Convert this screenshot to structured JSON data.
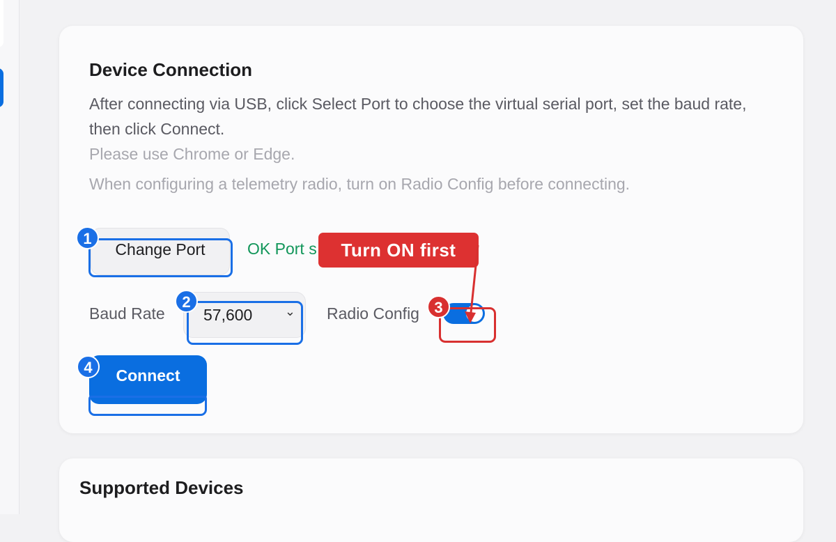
{
  "device_connection": {
    "title": "Device Connection",
    "description": "After connecting via USB, click Select Port to choose the virtual serial port, set the baud rate, then click Connect.",
    "note_browser": "Please use Chrome or Edge.",
    "note_radio": "When configuring a telemetry radio, turn on Radio Config before connecting.",
    "change_port_label": "Change Port",
    "port_status": "OK Port s",
    "baud_rate_label": "Baud Rate",
    "baud_rate_value": "57,600",
    "radio_config_label": "Radio Config",
    "radio_config_on": true,
    "connect_label": "Connect"
  },
  "supported_devices": {
    "title": "Supported Devices"
  },
  "annotations": {
    "callout_text": "Turn ON first",
    "steps": [
      "1",
      "2",
      "3",
      "4"
    ]
  },
  "colors": {
    "accent": "#0a6ee0",
    "success": "#12965a",
    "annotation_blue": "#1a6fe6",
    "annotation_red": "#d83030"
  },
  "icons": {
    "select_chevron": "chevron-down-icon",
    "callout_arrow": "arrow-down-icon"
  }
}
